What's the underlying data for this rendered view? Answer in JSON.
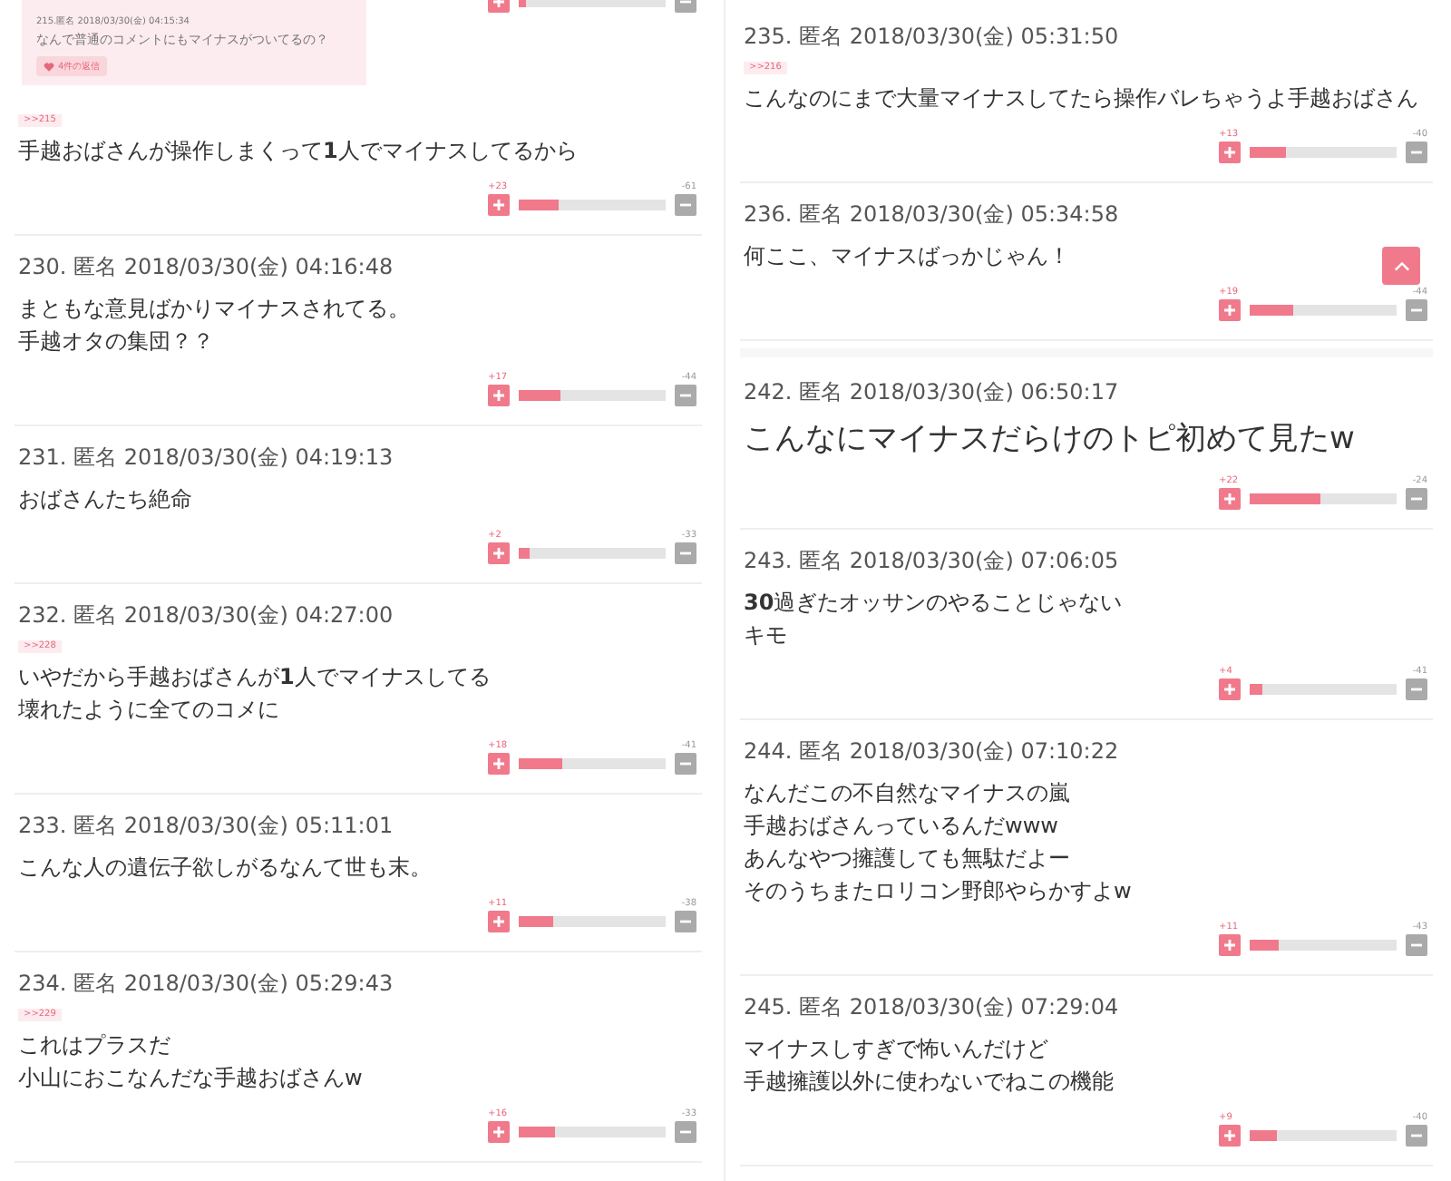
{
  "columns": [
    {
      "partial_vote": {
        "level": 0.05
      },
      "quote": {
        "header": "215.匿名 2018/03/30(金) 04:15:34",
        "text": "なんで普通のコメントにもマイナスがついてるの？",
        "button": "4件の返信"
      },
      "comments": [
        {
          "tag": ">>215",
          "body": [
            "手越おばさんが操作しまくって**1**人でマイナスしてるから"
          ],
          "plus": "+23",
          "minus": "-61",
          "level": 0.27,
          "kind": "normal"
        },
        {
          "header": "230. 匿名 2018/03/30(金) 04:16:48",
          "body": [
            "まともな意見ばかりマイナスされてる。",
            "手越オタの集団？？"
          ],
          "plus": "+17",
          "minus": "-44",
          "level": 0.28,
          "kind": "normal"
        },
        {
          "header": "231. 匿名 2018/03/30(金) 04:19:13",
          "body": [
            "おばさんたち絶命"
          ],
          "plus": "+2",
          "minus": "-33",
          "level": 0.08,
          "kind": "normal"
        },
        {
          "header": "232. 匿名 2018/03/30(金) 04:27:00",
          "tag": ">>228",
          "body": [
            "いやだから手越おばさんが**1**人でマイナスしてる",
            "壊れたように全てのコメに"
          ],
          "plus": "+18",
          "minus": "-41",
          "level": 0.3,
          "kind": "normal"
        },
        {
          "header": "233. 匿名 2018/03/30(金) 05:11:01",
          "body": [
            "こんな人の遺伝子欲しがるなんて世も末。"
          ],
          "plus": "+11",
          "minus": "-38",
          "level": 0.23,
          "kind": "normal"
        },
        {
          "header": "234. 匿名 2018/03/30(金) 05:29:43",
          "tag": ">>229",
          "body": [
            "これはプラスだ",
            "小山におこなんだな手越おばさんw"
          ],
          "plus": "+16",
          "minus": "-33",
          "level": 0.25,
          "kind": "normal"
        }
      ]
    },
    {
      "comments": [
        {
          "header": "235. 匿名 2018/03/30(金) 05:31:50",
          "tag": ">>216",
          "body": [
            "こんなのにまで大量マイナスしてたら操作バレちゃうよ手越おばさん"
          ],
          "plus": "+13",
          "minus": "-40",
          "level": 0.25,
          "kind": "normal"
        },
        {
          "header": "236. 匿名 2018/03/30(金) 05:34:58",
          "body": [
            "何ここ、マイナスばっかじゃん！"
          ],
          "plus": "+19",
          "minus": "-44",
          "level": 0.3,
          "kind": "normal"
        },
        {
          "header": "242. 匿名 2018/03/30(金) 06:50:17",
          "body": [
            "こんなにマイナスだらけのトピ初めて見たw"
          ],
          "plus": "+22",
          "minus": "-24",
          "level": 0.48,
          "kind": "large"
        },
        {
          "header": "243. 匿名 2018/03/30(金) 07:06:05",
          "body": [
            "**30**過ぎたオッサンのやることじゃない",
            "キモ"
          ],
          "plus": "+4",
          "minus": "-41",
          "level": 0.09,
          "kind": "normal"
        },
        {
          "header": "244. 匿名 2018/03/30(金) 07:10:22",
          "body": [
            "なんだこの不自然なマイナスの嵐",
            "手越おばさんっているんだwww",
            "あんなやつ擁護しても無駄だよー",
            "そのうちまたロリコン野郎やらかすよw"
          ],
          "plus": "+11",
          "minus": "-43",
          "level": 0.2,
          "kind": "normal"
        },
        {
          "header": "245. 匿名 2018/03/30(金) 07:29:04",
          "body": [
            "マイナスしすぎで怖いんだけど",
            "手越擁護以外に使わないでねこの機能"
          ],
          "plus": "+9",
          "minus": "-40",
          "level": 0.18,
          "kind": "normal"
        }
      ]
    }
  ],
  "scroll_top": {
    "shown": true
  }
}
